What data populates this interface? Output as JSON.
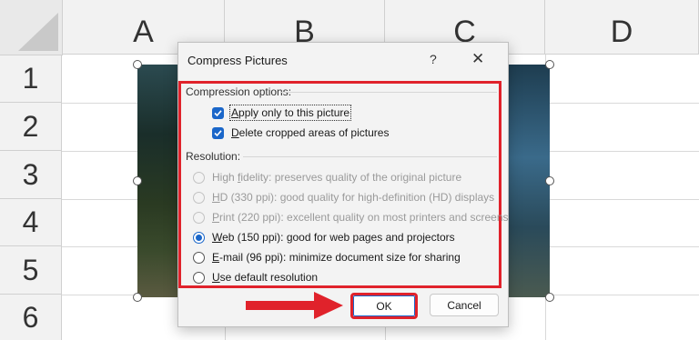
{
  "spreadsheet": {
    "columns": [
      "A",
      "B",
      "C",
      "D"
    ],
    "rows": [
      "1",
      "2",
      "3",
      "4",
      "5",
      "6"
    ]
  },
  "dialog": {
    "title": "Compress Pictures",
    "help": "?",
    "close": "✕",
    "compression": {
      "header": "Compression options:",
      "apply_label_key": "A",
      "apply_label_rest": "pply only to this picture",
      "apply_checked": true,
      "delete_label_key": "D",
      "delete_label_rest": "elete cropped areas of pictures",
      "delete_checked": true
    },
    "resolution": {
      "header": "Resolution:",
      "options": [
        {
          "pre": "High ",
          "key": "f",
          "post": "idelity: preserves quality of the original picture",
          "enabled": false,
          "selected": false
        },
        {
          "pre": "",
          "key": "H",
          "post": "D (330 ppi): good quality for high-definition (HD) displays",
          "enabled": false,
          "selected": false
        },
        {
          "pre": "",
          "key": "P",
          "post": "rint (220 ppi): excellent quality on most printers and screens",
          "enabled": false,
          "selected": false
        },
        {
          "pre": "",
          "key": "W",
          "post": "eb (150 ppi): good for web pages and projectors",
          "enabled": true,
          "selected": true
        },
        {
          "pre": "",
          "key": "E",
          "post": "-mail (96 ppi): minimize document size for sharing",
          "enabled": true,
          "selected": false
        },
        {
          "pre": "",
          "key": "U",
          "post": "se default resolution",
          "enabled": true,
          "selected": false
        }
      ]
    },
    "ok_label": "OK",
    "cancel_label": "Cancel"
  },
  "colors": {
    "highlight": "#e0222b",
    "accent": "#1a66c9"
  }
}
